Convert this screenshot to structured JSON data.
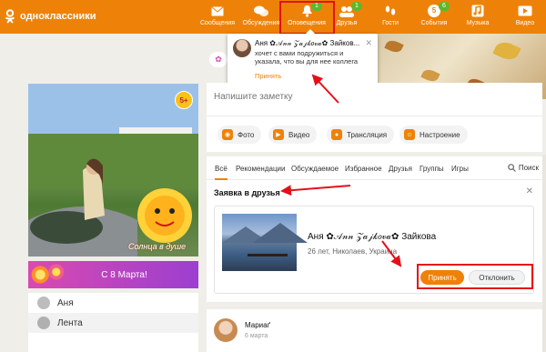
{
  "header": {
    "logo_text": "одноклассники",
    "nav": [
      {
        "label": "Сообщения",
        "icon": "envelope-icon",
        "badge": ""
      },
      {
        "label": "Обсуждения",
        "icon": "chat-bubbles-icon",
        "badge": ""
      },
      {
        "label": "Оповещения",
        "icon": "bell-icon",
        "badge": "1"
      },
      {
        "label": "Друзья",
        "icon": "friends-icon",
        "badge": "1"
      },
      {
        "label": "Гости",
        "icon": "footprints-icon",
        "badge": ""
      },
      {
        "label": "События",
        "icon": "events-icon",
        "badge": "6"
      },
      {
        "label": "Музыка",
        "icon": "music-note-icon",
        "badge": ""
      },
      {
        "label": "Видео",
        "icon": "video-icon",
        "badge": ""
      }
    ],
    "events_count": "5",
    "colors": {
      "accent": "#ee8208",
      "badge_green": "#5ab92c",
      "annotation_red": "#e3101a"
    }
  },
  "notification": {
    "name": "Аня ✿𝒜𝓃𝓃 𝒵𝒶𝒿𝓀𝑜𝓋𝒶✿ Зайков...",
    "text": "хочет с вами подружиться и указала, что вы для нее коллега",
    "accept_label": "Принять",
    "close_symbol": "✕"
  },
  "profile": {
    "photo_badge": "5+",
    "sticker_caption": "Солнца в душе",
    "banner_label": "С 8 Марта!"
  },
  "left_menu": {
    "items": [
      {
        "label": "Аня",
        "icon": "avatar-icon"
      },
      {
        "label": "Лента",
        "icon": "home-icon"
      }
    ]
  },
  "note": {
    "placeholder": "Напишите заметку",
    "actions": [
      {
        "label": "Фото",
        "icon": "camera-icon"
      },
      {
        "label": "Видео",
        "icon": "video-camera-icon"
      },
      {
        "label": "Трансляция",
        "icon": "broadcast-icon"
      },
      {
        "label": "Настроение",
        "icon": "smiley-icon"
      }
    ]
  },
  "feed": {
    "tabs": [
      "Всё",
      "Рекомендации",
      "Обсуждаемое",
      "Избранное",
      "Друзья",
      "Группы",
      "Игры"
    ],
    "active_tab": "Всё",
    "search_label": "Поиск"
  },
  "friend_request": {
    "title": "Заявка в друзья",
    "name": "Аня ✿𝒜𝓃𝓃 𝒵𝒶𝒿𝓀𝑜𝓋𝒶✿ Зайкова",
    "info": "26 лет, Николаев, Украина",
    "accept_label": "Принять",
    "decline_label": "Отклонить",
    "close_symbol": "✕"
  },
  "post": {
    "author": "Мариаґ",
    "date": "6 марта"
  }
}
